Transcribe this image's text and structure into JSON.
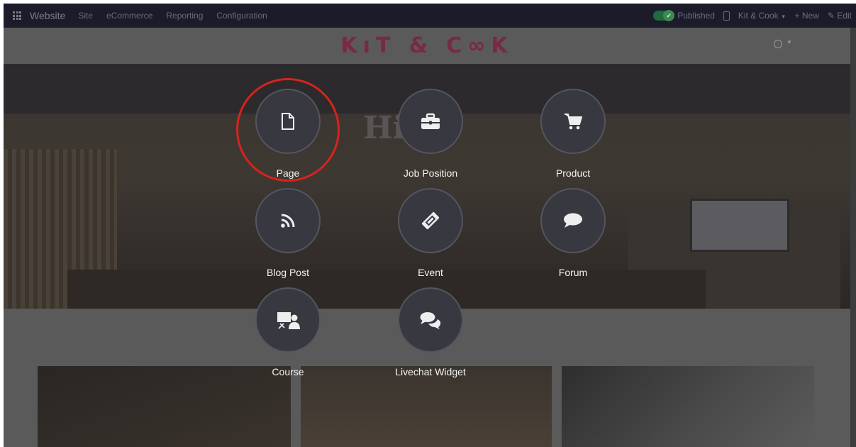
{
  "topbar": {
    "brand": "Website",
    "menu": [
      "Site",
      "eCommerce",
      "Reporting",
      "Configuration"
    ],
    "published": "Published",
    "website_name": "Kit & Cook",
    "new": "+ New",
    "edit": "Edit"
  },
  "header": {
    "logo": "KıT & C∞K"
  },
  "hero": {
    "title": "Hi    lo"
  },
  "dialog": {
    "options": [
      {
        "label": "Page",
        "icon": "file-icon"
      },
      {
        "label": "Job Position",
        "icon": "briefcase-icon"
      },
      {
        "label": "Product",
        "icon": "cart-icon"
      },
      {
        "label": "Blog Post",
        "icon": "rss-icon"
      },
      {
        "label": "Event",
        "icon": "ticket-icon"
      },
      {
        "label": "Forum",
        "icon": "comment-icon"
      },
      {
        "label": "Course",
        "icon": "course-icon"
      },
      {
        "label": "Livechat Widget",
        "icon": "comments-icon"
      }
    ]
  },
  "colors": {
    "highlight": "#d9221e",
    "published_toggle": "#3b8a55",
    "logo": "#7a2a40"
  }
}
